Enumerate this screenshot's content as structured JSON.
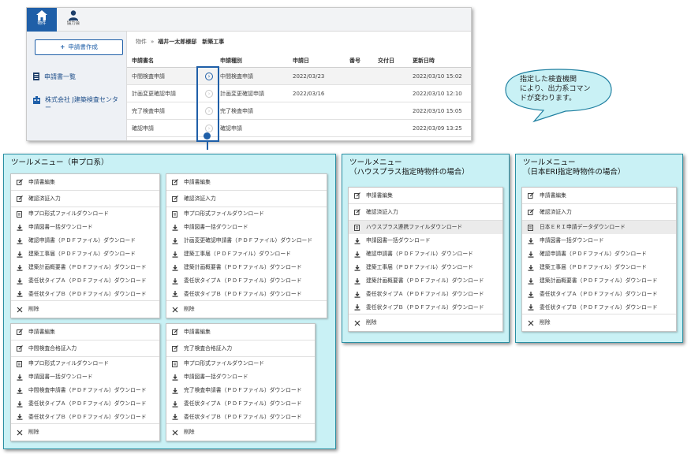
{
  "app": {
    "nav": [
      {
        "label": "物件"
      },
      {
        "label": "協力会"
      }
    ],
    "create_button": "申請書作成",
    "sidebar_items": [
      {
        "label": "申請書一覧"
      },
      {
        "label_line1": "株式会社 J建築検査センタ",
        "label_line2": "ー"
      }
    ],
    "breadcrumb": {
      "root": "物件",
      "separator": "»",
      "current": "福井一太郎様邸　新築工事"
    },
    "table": {
      "columns": [
        "申請書名",
        "申請種別",
        "申請日",
        "番号",
        "交付日",
        "更新日時"
      ],
      "rows": [
        {
          "name": "中間検査申請",
          "type": "中間検査申請",
          "date": "2022/03/23",
          "number": "",
          "issued": "",
          "updated": "2022/03/10 15:02",
          "selected": true
        },
        {
          "name": "計画変更確認申請",
          "type": "計画変更確認申請",
          "date": "2022/03/16",
          "number": "",
          "issued": "",
          "updated": "2022/03/10 12:10",
          "selected": false
        },
        {
          "name": "完了検査申請",
          "type": "完了検査申請",
          "date": "",
          "number": "",
          "issued": "",
          "updated": "2022/03/10 15:05",
          "selected": false
        },
        {
          "name": "確認申請",
          "type": "確認申請",
          "date": "",
          "number": "",
          "issued": "",
          "updated": "2022/03/09 13:25",
          "selected": false
        }
      ]
    }
  },
  "callout": {
    "lines": [
      "指定した検査機関",
      "により、出力系コマン",
      "ドが変わります。"
    ]
  },
  "panels": {
    "shinpuro": {
      "title": "ツールメニュー（申プロ系）",
      "menus": [
        {
          "items": [
            {
              "icon": "edit",
              "label": "申請書編集"
            },
            {
              "icon": "edit",
              "label": "確認済証入力"
            },
            {
              "icon": "doc",
              "label": "申プロ形式ファイルダウンロード"
            },
            {
              "icon": "download",
              "label": "申請図書一括ダウンロード"
            },
            {
              "icon": "download",
              "label": "確認申請書（ＰＤＦファイル）ダウンロード"
            },
            {
              "icon": "download",
              "label": "建築工事届（ＰＤＦファイル）ダウンロード"
            },
            {
              "icon": "download",
              "label": "建築計画概要書（ＰＤＦファイル）ダウンロード"
            },
            {
              "icon": "download",
              "label": "委任状タイプＡ（ＰＤＦファイル）ダウンロード"
            },
            {
              "icon": "download",
              "label": "委任状タイプＢ（ＰＤＦファイル）ダウンロード"
            },
            {
              "icon": "close",
              "label": "削除"
            }
          ]
        },
        {
          "items": [
            {
              "icon": "edit",
              "label": "申請書編集"
            },
            {
              "icon": "edit",
              "label": "確認済証入力"
            },
            {
              "icon": "doc",
              "label": "申プロ形式ファイルダウンロード"
            },
            {
              "icon": "download",
              "label": "申請図書一括ダウンロード"
            },
            {
              "icon": "download",
              "label": "計画変更確認申請書（ＰＤＦファイル）ダウンロード"
            },
            {
              "icon": "download",
              "label": "建築工事届（ＰＤＦファイル）ダウンロード"
            },
            {
              "icon": "download",
              "label": "建築計画概要書（ＰＤＦファイル）ダウンロード"
            },
            {
              "icon": "download",
              "label": "委任状タイプＡ（ＰＤＦファイル）ダウンロード"
            },
            {
              "icon": "download",
              "label": "委任状タイプＢ（ＰＤＦファイル）ダウンロード"
            },
            {
              "icon": "close",
              "label": "削除"
            }
          ]
        },
        {
          "items": [
            {
              "icon": "edit",
              "label": "申請書編集"
            },
            {
              "icon": "edit",
              "label": "中間検査合格証入力"
            },
            {
              "icon": "doc",
              "label": "申プロ形式ファイルダウンロード"
            },
            {
              "icon": "download",
              "label": "申請図書一括ダウンロード"
            },
            {
              "icon": "download",
              "label": "中間検査申請書（ＰＤＦファイル）ダウンロード"
            },
            {
              "icon": "download",
              "label": "委任状タイプＡ（ＰＤＦファイル）ダウンロード"
            },
            {
              "icon": "download",
              "label": "委任状タイプＢ（ＰＤＦファイル）ダウンロード"
            },
            {
              "icon": "close",
              "label": "削除"
            }
          ]
        },
        {
          "items": [
            {
              "icon": "edit",
              "label": "申請書編集"
            },
            {
              "icon": "edit",
              "label": "完了検査合格証入力"
            },
            {
              "icon": "doc",
              "label": "申プロ形式ファイルダウンロード"
            },
            {
              "icon": "download",
              "label": "申請図書一括ダウンロード"
            },
            {
              "icon": "download",
              "label": "完了検査申請書（ＰＤＦファイル）ダウンロード"
            },
            {
              "icon": "download",
              "label": "委任状タイプＡ（ＰＤＦファイル）ダウンロード"
            },
            {
              "icon": "download",
              "label": "委任状タイプＢ（ＰＤＦファイル）ダウンロード"
            },
            {
              "icon": "close",
              "label": "削除"
            }
          ]
        }
      ]
    },
    "houseplus": {
      "title_line1": "ツールメニュー",
      "title_line2": "（ハウスプラス指定時物件の場合）",
      "items": [
        {
          "icon": "edit",
          "label": "申請書編集"
        },
        {
          "icon": "edit",
          "label": "確認済証入力"
        },
        {
          "icon": "doc",
          "label": "ハウスプラス連携ファイルダウンロード",
          "highlight": true
        },
        {
          "icon": "download",
          "label": "申請図書一括ダウンロード"
        },
        {
          "icon": "download",
          "label": "確認申請書（ＰＤＦファイル）ダウンロード"
        },
        {
          "icon": "download",
          "label": "建築工事届（ＰＤＦファイル）ダウンロード"
        },
        {
          "icon": "download",
          "label": "建築計画概要書（ＰＤＦファイル）ダウンロード"
        },
        {
          "icon": "download",
          "label": "委任状タイプＡ（ＰＤＦファイル）ダウンロード"
        },
        {
          "icon": "download",
          "label": "委任状タイプＢ（ＰＤＦファイル）ダウンロード"
        },
        {
          "icon": "close",
          "label": "削除"
        }
      ]
    },
    "eri": {
      "title_line1": "ツールメニュー",
      "title_line2": "（日本ERI指定時物件の場合）",
      "items": [
        {
          "icon": "edit",
          "label": "申請書編集"
        },
        {
          "icon": "edit",
          "label": "確認済証入力"
        },
        {
          "icon": "doc",
          "label": "日本ＥＲＩ申請データダウンロード",
          "highlight": true
        },
        {
          "icon": "download",
          "label": "申請図書一括ダウンロード"
        },
        {
          "icon": "download",
          "label": "確認申請書（ＰＤＦファイル）ダウンロード"
        },
        {
          "icon": "download",
          "label": "建築工事届（ＰＤＦファイル）ダウンロード"
        },
        {
          "icon": "download",
          "label": "建築計画概要書（ＰＤＦファイル）ダウンロード"
        },
        {
          "icon": "download",
          "label": "委任状タイプＡ（ＰＤＦファイル）ダウンロード"
        },
        {
          "icon": "download",
          "label": "委任状タイプＢ（ＰＤＦファイル）ダウンロード"
        },
        {
          "icon": "close",
          "label": "削除"
        }
      ]
    }
  },
  "colors": {
    "accent": "#1f5fa8",
    "panel_bg": "#c9f1f5",
    "callout_bg": "#c9f1f5"
  }
}
